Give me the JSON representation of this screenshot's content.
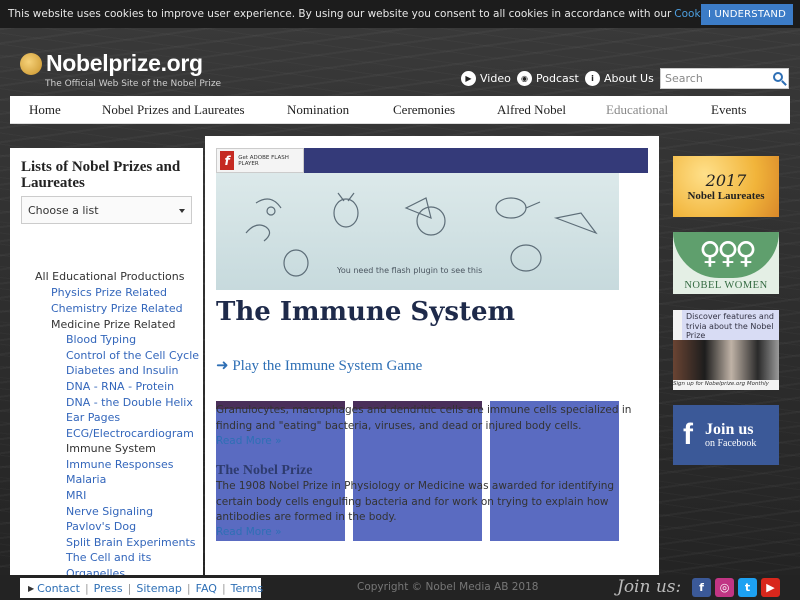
{
  "cookie": {
    "text": "This website uses cookies to improve user experience. By using our website you consent to all cookies in accordance with our",
    "link": "Cookie Policy",
    "end": ".",
    "button": "I UNDERSTAND"
  },
  "header": {
    "site_name": "Nobelprize.org",
    "tagline": "The Official Web Site of the Nobel Prize",
    "video": "Video",
    "podcast": "Podcast",
    "about": "About Us",
    "search_placeholder": "Search"
  },
  "nav": [
    "Home",
    "Nobel Prizes and Laureates",
    "Nomination",
    "Ceremonies",
    "Alfred Nobel",
    "Educational",
    "Events"
  ],
  "sidebar": {
    "heading": "Lists of Nobel Prizes and Laureates",
    "select": "Choose a list",
    "items": [
      "All Educational Productions",
      "Physics Prize Related",
      "Chemistry Prize Related",
      "Medicine Prize Related",
      "Blood Typing",
      "Control of the Cell Cycle",
      "Diabetes and Insulin",
      "DNA - RNA - Protein",
      "DNA - the Double Helix",
      "Ear Pages",
      "ECG/Electrocardiogram",
      "Immune System",
      "Immune Responses",
      "Malaria",
      "MRI",
      "Nerve Signaling",
      "Pavlov's Dog",
      "Split Brain Experiments",
      "The Cell and its",
      "Organelles"
    ]
  },
  "main": {
    "flash_get": "Get ADOBE FLASH PLAYER",
    "flash_msg": "You need the flash plugin to see this",
    "title": "The Immune System",
    "play": "Play the Immune System Game",
    "para1": "Granulocytes, macrophages and dendritic cells are immune cells specialized in finding and \"eating\" bacteria, viruses, and dead or injured body cells.",
    "more1": "Read More »",
    "subhead": "The Nobel Prize",
    "para2": "The 1908 Nobel Prize in Physiology or Medicine was awarded for identifying certain body cells engulfing bacteria and for work on trying to explain how antibodies are formed in the body.",
    "more2": "Read More »"
  },
  "right": {
    "laureates_year": "2017",
    "laureates_label": "Nobel Laureates",
    "women_label": "NOBEL WOMEN",
    "discover": "Discover features and trivia about the Nobel Prize",
    "signup": "Sign up for Nobelprize.org Monthly",
    "join1": "Join us",
    "join2": "on Facebook"
  },
  "footer": {
    "links": [
      "Contact",
      "Press",
      "Sitemap",
      "FAQ",
      "Terms"
    ],
    "copyright": "Copyright © Nobel Media AB 2018",
    "joinus": "Join us:"
  },
  "colors": {
    "nav_bg": "#ffffff",
    "accent_blue": "#2e6fb5",
    "tile_blue": "#5a6bc1",
    "facebook": "#3b5998"
  }
}
